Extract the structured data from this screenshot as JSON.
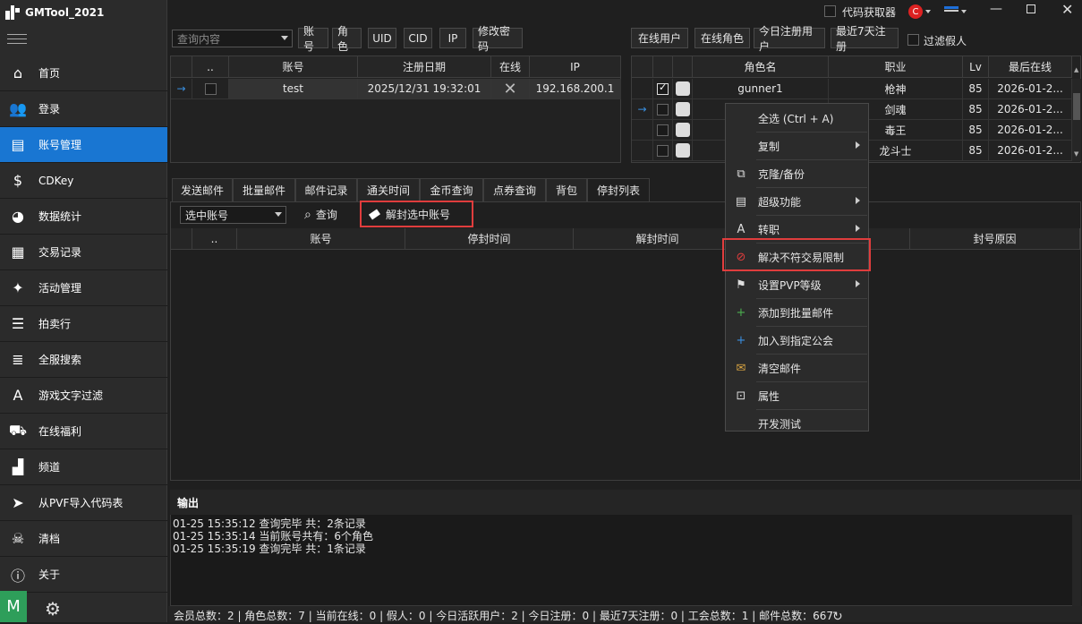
{
  "app": {
    "title": "GMTool_2021"
  },
  "titlebar": {
    "code_fetcher_label": "代码获取器"
  },
  "sidebar": {
    "items": [
      {
        "label": "首页",
        "icon": "home-icon"
      },
      {
        "label": "登录",
        "icon": "users-icon"
      },
      {
        "label": "账号管理",
        "icon": "id-card-icon"
      },
      {
        "label": "CDKey",
        "icon": "dollar-icon"
      },
      {
        "label": "数据统计",
        "icon": "pie-chart-icon"
      },
      {
        "label": "交易记录",
        "icon": "log-icon"
      },
      {
        "label": "活动管理",
        "icon": "ticket-icon"
      },
      {
        "label": "拍卖行",
        "icon": "database-user-icon"
      },
      {
        "label": "全服搜索",
        "icon": "server-icon"
      },
      {
        "label": "游戏文字过滤",
        "icon": "text-filter-icon"
      },
      {
        "label": "在线福利",
        "icon": "truck-icon"
      },
      {
        "label": "频道",
        "icon": "factory-icon"
      },
      {
        "label": "从PVF导入代码表",
        "icon": "cursor-icon"
      },
      {
        "label": "清档",
        "icon": "skull-icon"
      },
      {
        "label": "关于",
        "icon": "info-icon"
      }
    ],
    "active_index": 2,
    "footer_badge": "M"
  },
  "toolbar_left": {
    "search_placeholder": "查询内容",
    "buttons": [
      "账号",
      "角色",
      "UID",
      "CID",
      "IP",
      "修改密码"
    ]
  },
  "toolbar_right": {
    "buttons": [
      "在线用户",
      "在线角色",
      "今日注册用户",
      "最近7天注册"
    ],
    "filter_label": "过滤假人"
  },
  "account_table": {
    "headers": [
      "..",
      "账号",
      "注册日期",
      "在线",
      "IP"
    ],
    "rows": [
      {
        "account": "test",
        "date": "2025/12/31 19:32:01",
        "ip": "192.168.200.1"
      }
    ]
  },
  "role_table": {
    "headers": [
      "角色名",
      "职业",
      "Lv",
      "最后在线"
    ],
    "rows": [
      {
        "name": "gunner1",
        "job": "枪神",
        "lv": "85",
        "last": "2026-01-2...",
        "checked": true
      },
      {
        "name": "",
        "job": "剑魂",
        "lv": "85",
        "last": "2026-01-2...",
        "checked": false
      },
      {
        "name": "",
        "job": "毒王",
        "lv": "85",
        "last": "2026-01-2...",
        "checked": false
      },
      {
        "name": "",
        "job": "龙斗士",
        "lv": "85",
        "last": "2026-01-2...",
        "checked": false
      }
    ]
  },
  "tabs": [
    "发送邮件",
    "批量邮件",
    "邮件记录",
    "通关时间",
    "金币查询",
    "点券查询",
    "背包",
    "停封列表"
  ],
  "active_tab": 7,
  "ban_panel": {
    "combo_value": "选中账号",
    "query_label": "查询",
    "unban_label": "解封选中账号",
    "headers": [
      "..",
      "账号",
      "停封时间",
      "解封时间",
      "",
      "封号原因"
    ]
  },
  "context_menu": {
    "items": [
      {
        "label": "全选 (Ctrl + A)",
        "icon": "",
        "submenu": false
      },
      {
        "label": "复制",
        "icon": "",
        "submenu": true
      },
      {
        "label": "克隆/备份",
        "icon": "copy-icon",
        "submenu": false
      },
      {
        "label": "超级功能",
        "icon": "id-card-icon",
        "submenu": true
      },
      {
        "label": "转职",
        "icon": "font-icon",
        "submenu": true
      },
      {
        "label": "解决不符交易限制",
        "icon": "forbidden-icon",
        "submenu": false
      },
      {
        "label": "设置PVP等级",
        "icon": "pvp-icon",
        "submenu": true
      },
      {
        "label": "添加到批量邮件",
        "icon": "plus-green-icon",
        "submenu": false
      },
      {
        "label": "加入到指定公会",
        "icon": "plus-blue-icon",
        "submenu": false
      },
      {
        "label": "清空邮件",
        "icon": "mail-clear-icon",
        "submenu": false
      },
      {
        "label": "属性",
        "icon": "properties-icon",
        "submenu": false
      },
      {
        "label": "开发测试",
        "icon": "",
        "submenu": false
      }
    ]
  },
  "output": {
    "title": "输出",
    "lines": [
      "01-25 15:35:12 查询完毕 共：2条记录",
      "01-25 15:35:14 当前账号共有：6个角色",
      "01-25 15:35:19 查询完毕 共：1条记录"
    ]
  },
  "statusbar": {
    "text": "会员总数：2 | 角色总数：7 | 当前在线：0 | 假人：0 | 今日活跃用户：2 | 今日注册：0 | 最近7天注册：0 | 工会总数：1 | 邮件总数：667"
  },
  "colors": {
    "accent": "#1976d2",
    "highlight_border": "#e03d3d",
    "footer_badge": "#2e9e5a"
  }
}
